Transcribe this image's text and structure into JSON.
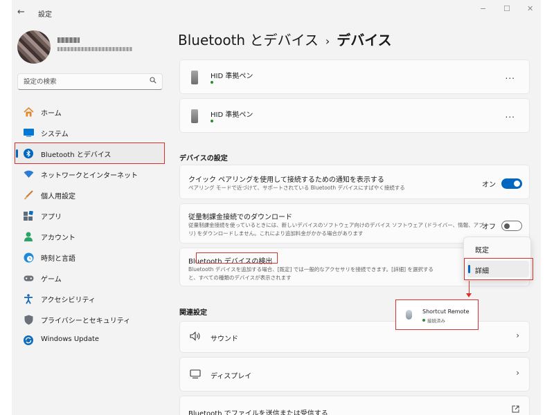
{
  "titlebar": {
    "back": "←",
    "app_title": "設定",
    "minimize": "−",
    "maximize": "☐",
    "close": "✕"
  },
  "search": {
    "placeholder": "設定の検索",
    "icon": "search-icon"
  },
  "sidebar": {
    "items": [
      {
        "label": "ホーム",
        "icon": "home-icon",
        "color": "#e5862b"
      },
      {
        "label": "システム",
        "icon": "system-icon",
        "color": "#0078d4"
      },
      {
        "label": "Bluetooth とデバイス",
        "icon": "bluetooth-icon",
        "color": "#0067c0",
        "active": true
      },
      {
        "label": "ネットワークとインターネット",
        "icon": "network-icon",
        "color": "#2d7bd4"
      },
      {
        "label": "個人用設定",
        "icon": "brush-icon",
        "color": "#c77d36"
      },
      {
        "label": "アプリ",
        "icon": "apps-icon",
        "color": "#5e6b78"
      },
      {
        "label": "アカウント",
        "icon": "account-icon",
        "color": "#2aa46a"
      },
      {
        "label": "時刻と言語",
        "icon": "clock-globe-icon",
        "color": "#1f8ad6"
      },
      {
        "label": "ゲーム",
        "icon": "gamepad-icon",
        "color": "#6b7178"
      },
      {
        "label": "アクセシビリティ",
        "icon": "accessibility-icon",
        "color": "#1368b9"
      },
      {
        "label": "プライバシーとセキュリティ",
        "icon": "shield-icon",
        "color": "#6b7178"
      },
      {
        "label": "Windows Update",
        "icon": "update-icon",
        "color": "#0f6cbd"
      }
    ]
  },
  "main": {
    "breadcrumb_parent": "Bluetooth とデバイス",
    "breadcrumb_sep": "›",
    "breadcrumb_current": "デバイス",
    "devices": [
      {
        "name": "HID 準拠ペン",
        "more": "..."
      },
      {
        "name": "HID 準拠ペン",
        "more": "..."
      }
    ],
    "device_settings_title": "デバイスの設定",
    "quick_pairing": {
      "title": "クイック ペアリングを使用して接続するための通知を表示する",
      "desc": "ペアリング モードで近づけて、サポートされている Bluetooth デバイスにすばやく接続する",
      "toggle_label": "オン"
    },
    "metered": {
      "title": "従量制課金接続でのダウンロード",
      "desc1": "従量制課金接続を使っているときには、新しいデバイスのソフトウェア向けのデバイス ソフトウェア (ドライバー、情報、アプ",
      "desc2": "リ) をダウンロードしません。これにより追加料金がかかる場合があります",
      "toggle_label": "オフ"
    },
    "discovery": {
      "title": "Bluetooth デバイスの検出",
      "desc1": "Bluetooth デバイスを追加する場合、[既定] では一般的なアクセサリを接続できます。[詳細] を選択する",
      "desc2": "と、すべての種類のデバイスが表示されます",
      "options": [
        "既定",
        "詳細"
      ],
      "selected": "詳細"
    },
    "popup_device": {
      "name": "Shortcut Remote",
      "status": "接続済み"
    },
    "related_title": "関連設定",
    "related": [
      {
        "label": "サウンド",
        "icon": "speaker-icon",
        "glyph": "🔈",
        "chevron": "›"
      },
      {
        "label": "ディスプレイ",
        "icon": "monitor-icon",
        "glyph": "▭",
        "chevron": "›"
      },
      {
        "label": "Bluetooth でファイルを送信または受信する",
        "icon": "external-link-icon",
        "glyph": "↗"
      }
    ]
  }
}
